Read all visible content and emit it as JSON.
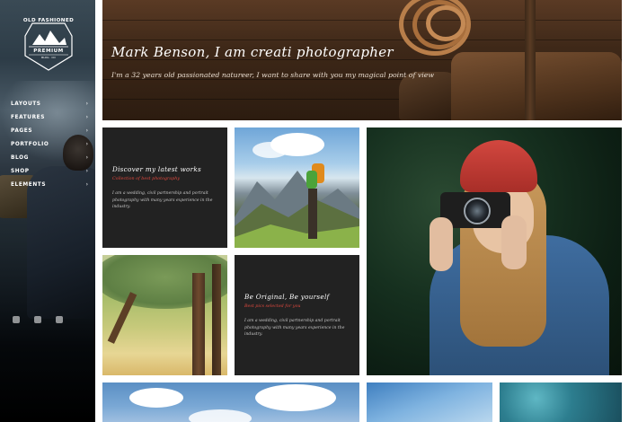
{
  "logo": {
    "top": "OLD FASHIONED",
    "company": "COMPANY",
    "premium": "PREMIUM",
    "small": "BLOG · CO"
  },
  "nav": {
    "items": [
      {
        "label": "LAYOUTS",
        "arrow": "›"
      },
      {
        "label": "FEATURES",
        "arrow": "›"
      },
      {
        "label": "PAGES",
        "arrow": "›"
      },
      {
        "label": "PORTFOLIO",
        "arrow": "›"
      },
      {
        "label": "BLOG",
        "arrow": "›"
      },
      {
        "label": "SHOP",
        "arrow": "›"
      },
      {
        "label": "ELEMENTS",
        "arrow": "›"
      }
    ]
  },
  "hero": {
    "title": "Mark Benson, I am creati photographer",
    "subtitle": "I'm a 32 years old passionated natureer, I want to share with you my magical point of view"
  },
  "tiles": {
    "latest": {
      "heading": "Discover my latest works",
      "sub": "Collection of best photography",
      "body": "I am a wedding, civil partnership and portrait photography with many years experience in the industry."
    },
    "original": {
      "heading": "Be Original, Be yourself",
      "sub": "Best pics selected for you",
      "body": "I am a wedding, civil partnership and portrait photography with many years experience in the industry."
    }
  },
  "colors": {
    "accent": "#e0493e",
    "tile_bg": "#222222"
  }
}
